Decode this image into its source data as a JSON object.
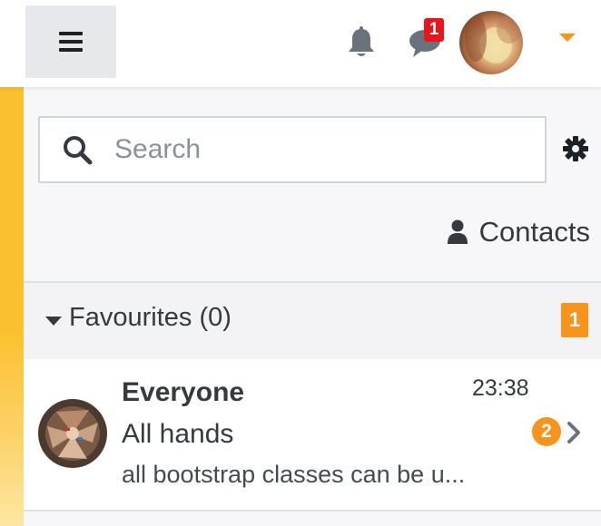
{
  "navbar": {
    "menu_icon": "hamburger-icon",
    "notifications_icon": "bell-icon",
    "messages_icon": "chat-bubble-icon",
    "messages_badge": "1",
    "user_menu_icon": "caret-down-icon"
  },
  "drawer": {
    "search": {
      "placeholder": "Search",
      "value": ""
    },
    "settings_icon": "gear-icon",
    "contacts_label": "Contacts",
    "favourites": {
      "label": "Favourites (0)",
      "badge": "1"
    },
    "conversations": [
      {
        "name": "Everyone",
        "time": "23:38",
        "subtitle": "All hands",
        "preview": "all bootstrap classes can be u...",
        "unread": "2"
      }
    ]
  },
  "colors": {
    "accent": "#f7941d",
    "notification_red": "#e8141e",
    "sidebar_yellow": "#fbc02d",
    "drawer_bg": "#f7f7f9"
  }
}
